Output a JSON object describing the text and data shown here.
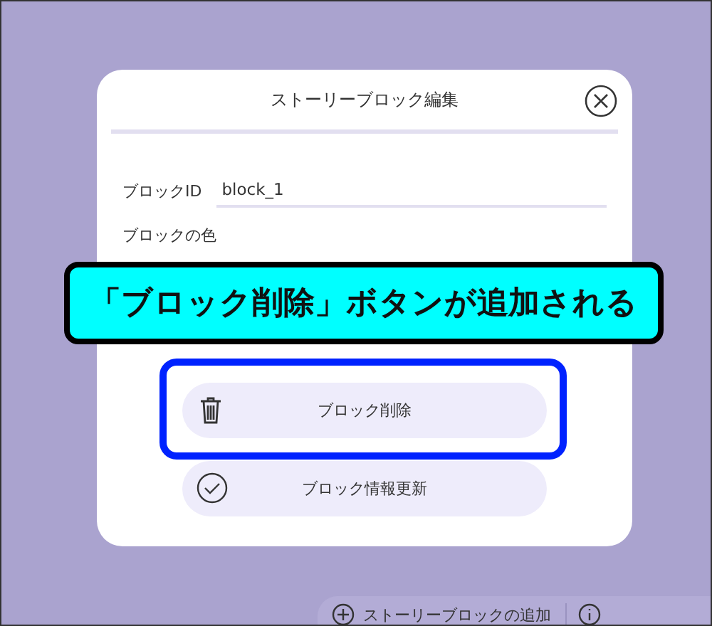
{
  "dialog": {
    "title": "ストーリーブロック編集",
    "fields": [
      {
        "label": "ブロックID",
        "value": "block_1"
      },
      {
        "label": "ブロックの色"
      }
    ],
    "buttons": [
      {
        "kind": "delete",
        "label": "ブロック削除",
        "highlighted": true
      },
      {
        "kind": "update",
        "label": "ブロック情報更新",
        "highlighted": false
      }
    ]
  },
  "callout": {
    "text": "「ブロック削除」ボタンが追加される"
  },
  "toolbar": {
    "add_label": "ストーリーブロックの追加"
  }
}
